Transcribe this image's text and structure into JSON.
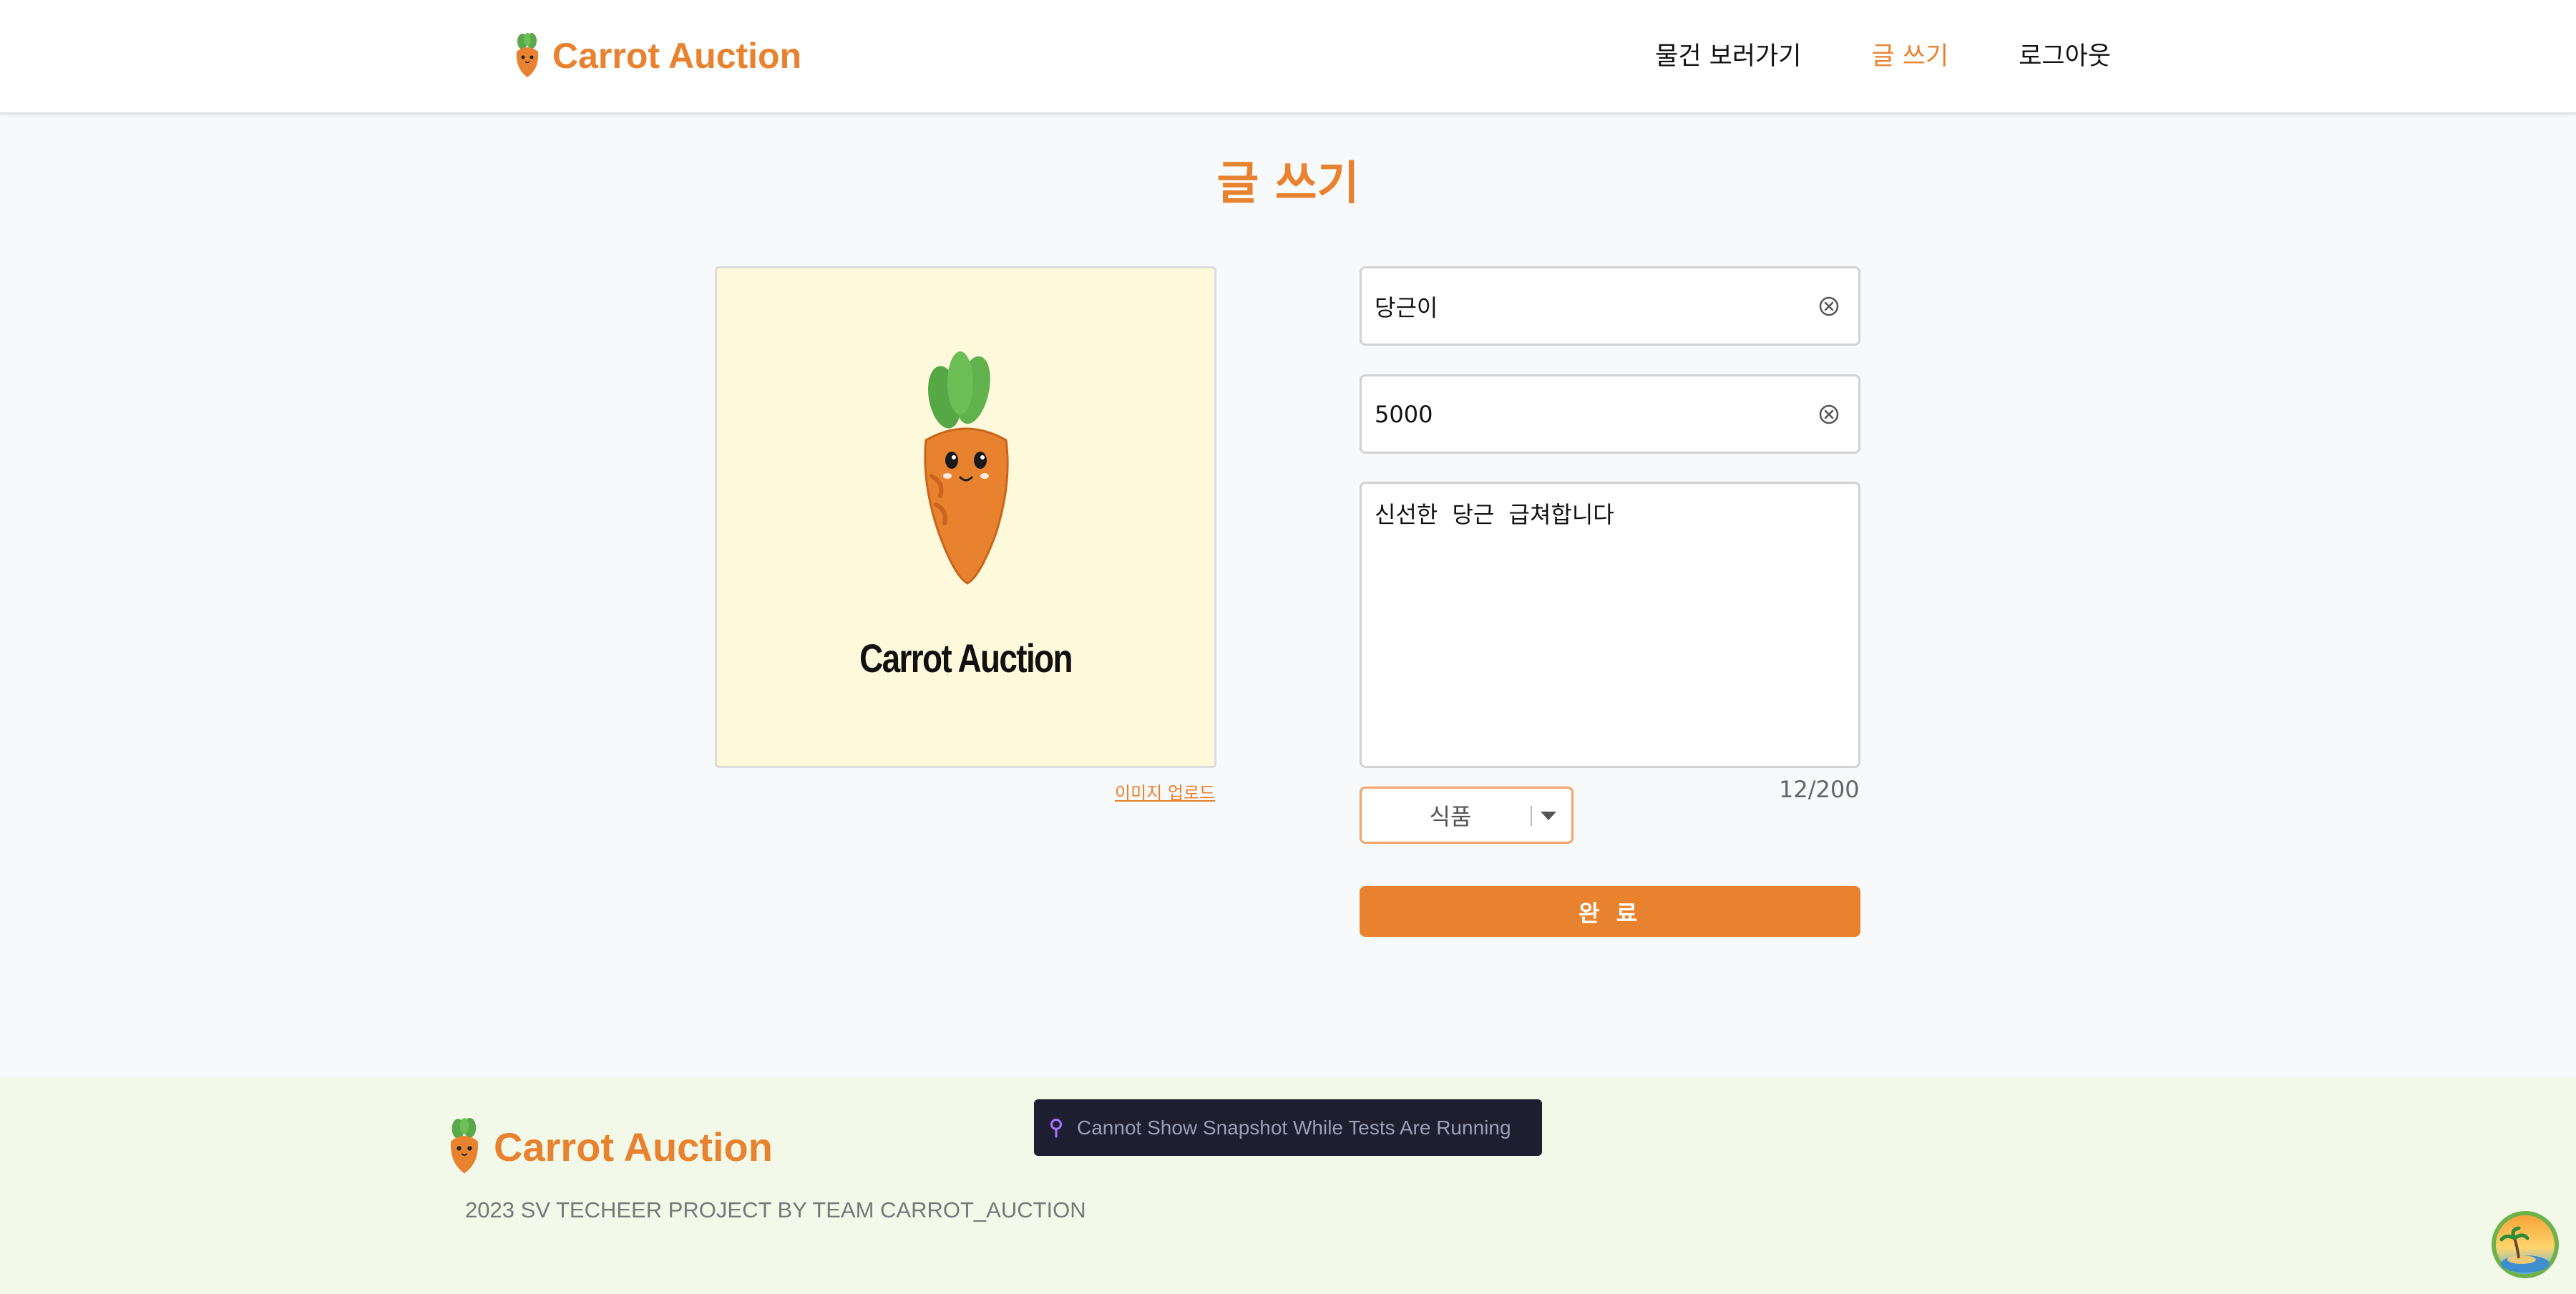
{
  "brand": {
    "name": "Carrot Auction"
  },
  "nav": {
    "items": [
      {
        "label": "물건 보러가기",
        "active": false
      },
      {
        "label": "글 쓰기",
        "active": true
      },
      {
        "label": "로그아웃",
        "active": false
      }
    ]
  },
  "page": {
    "title": "글 쓰기"
  },
  "image_panel": {
    "brand_text": "Carrot Auction",
    "upload_label": "이미지 업로드"
  },
  "form": {
    "title_value": "당근이",
    "price_value": "5000",
    "description_value": "신선한 당근 급쳐합니다",
    "char_count": "12/200",
    "category_selected": "식품",
    "submit_label": "완 료"
  },
  "footer": {
    "copyright": "2023 SV TECHEER PROJECT BY TEAM CARROT_AUCTION"
  },
  "toast": {
    "message": "Cannot Show Snapshot While Tests Are Running"
  },
  "colors": {
    "accent": "#e8822e",
    "footer_bg": "#f2f9e9",
    "image_bg": "#fef9db",
    "toast_bg": "#1d1e2f"
  },
  "icons": [
    "carrot-logo-icon",
    "clear-icon",
    "chevron-down-icon",
    "pin-icon",
    "assistant-avatar-icon"
  ]
}
